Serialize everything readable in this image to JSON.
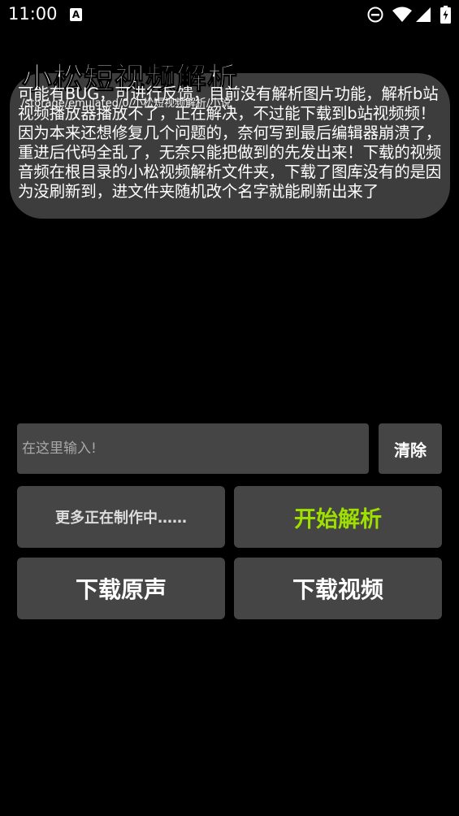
{
  "status_bar": {
    "time": "11:00",
    "notification_icon": "a-icon",
    "icons": [
      "do-not-disturb-icon",
      "wifi-icon",
      "signal-icon",
      "battery-icon"
    ]
  },
  "header": {
    "title": "小松短视频解析",
    "subtitle_path": "/storage/emulated/0/小松短视频解析/小说",
    "notice": "可能有BUG，可进行反馈，目前没有解析图片功能，解析b站视频播放器播放不了，正在解决，不过能下载到b站视频频！因为本来还想修复几个问题的，奈何写到最后编辑器崩溃了，重进后代码全乱了，无奈只能把做到的先发出来！下载的视频音频在根目录的小松视频解析文件夹，下载了图库没有的是因为没刷新到，进文件夹随机改个名字就能刷新出来了"
  },
  "input": {
    "placeholder": "在这里输入!",
    "value": ""
  },
  "buttons": {
    "clear": "清除",
    "more": "更多正在制作中……",
    "parse": "开始解析",
    "download_audio": "下载原声",
    "download_video": "下载视频"
  },
  "colors": {
    "background": "#000000",
    "panel": "#454545",
    "card": "#3d3d3d",
    "accent_green": "#9ee000"
  }
}
